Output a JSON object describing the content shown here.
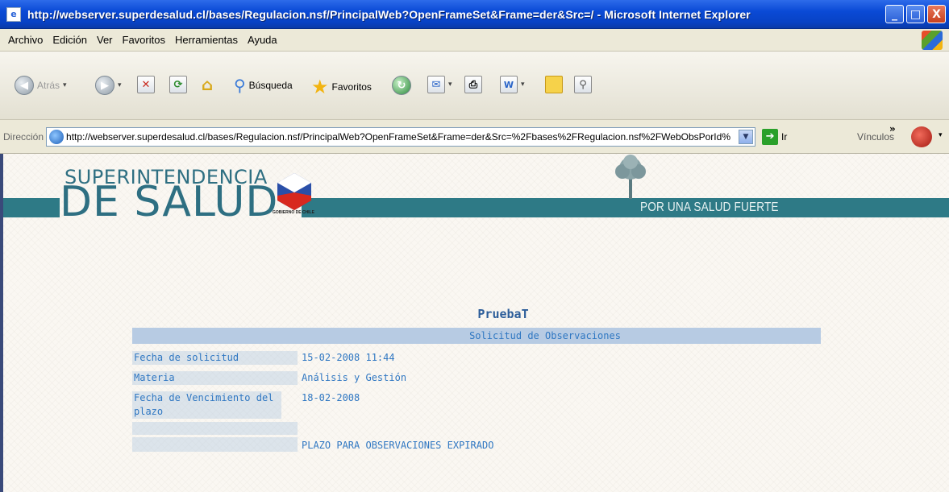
{
  "window": {
    "title": "http://webserver.superdesalud.cl/bases/Regulacion.nsf/PrincipalWeb?OpenFrameSet&Frame=der&Src=/ - Microsoft Internet Explorer",
    "minimize": "_",
    "maximize": "□",
    "close": "X"
  },
  "menu": {
    "items": [
      "Archivo",
      "Edición",
      "Ver",
      "Favoritos",
      "Herramientas",
      "Ayuda"
    ]
  },
  "toolbar": {
    "back_label": "Atrás",
    "search_label": "Búsqueda",
    "favorites_label": "Favoritos"
  },
  "address": {
    "label": "Dirección",
    "url": "http://webserver.superdesalud.cl/bases/Regulacion.nsf/PrincipalWeb?OpenFrameSet&Frame=der&Src=%2Fbases%2FRegulacion.nsf%2FWebObsPorId%",
    "go_label": "Ir",
    "links_label": "Vínculos",
    "links_chevron": "»"
  },
  "site": {
    "logo_line1": "SUPERINTENDENCIA",
    "logo_line2": "DE SALUD",
    "gov_text": "GOBIERNO DE CHILE",
    "slogan": "POR UNA SALUD FUERTE"
  },
  "form": {
    "title": "PruebaT",
    "section_header": "Solicitud de Observaciones",
    "fields": [
      {
        "label": "Fecha de solicitud",
        "value": "15-02-2008 11:44"
      },
      {
        "label": "Materia",
        "value": "Análisis y Gestión"
      },
      {
        "label": "Fecha de Vencimiento del plazo",
        "value": "18-02-2008"
      }
    ],
    "status": "PLAZO PARA OBSERVACIONES EXPIRADO"
  },
  "colors": {
    "titlebar": "#0a4ad6",
    "brand_teal": "#2e7a86",
    "form_text": "#2f77c2",
    "form_header_bg": "#b7cbe3"
  }
}
